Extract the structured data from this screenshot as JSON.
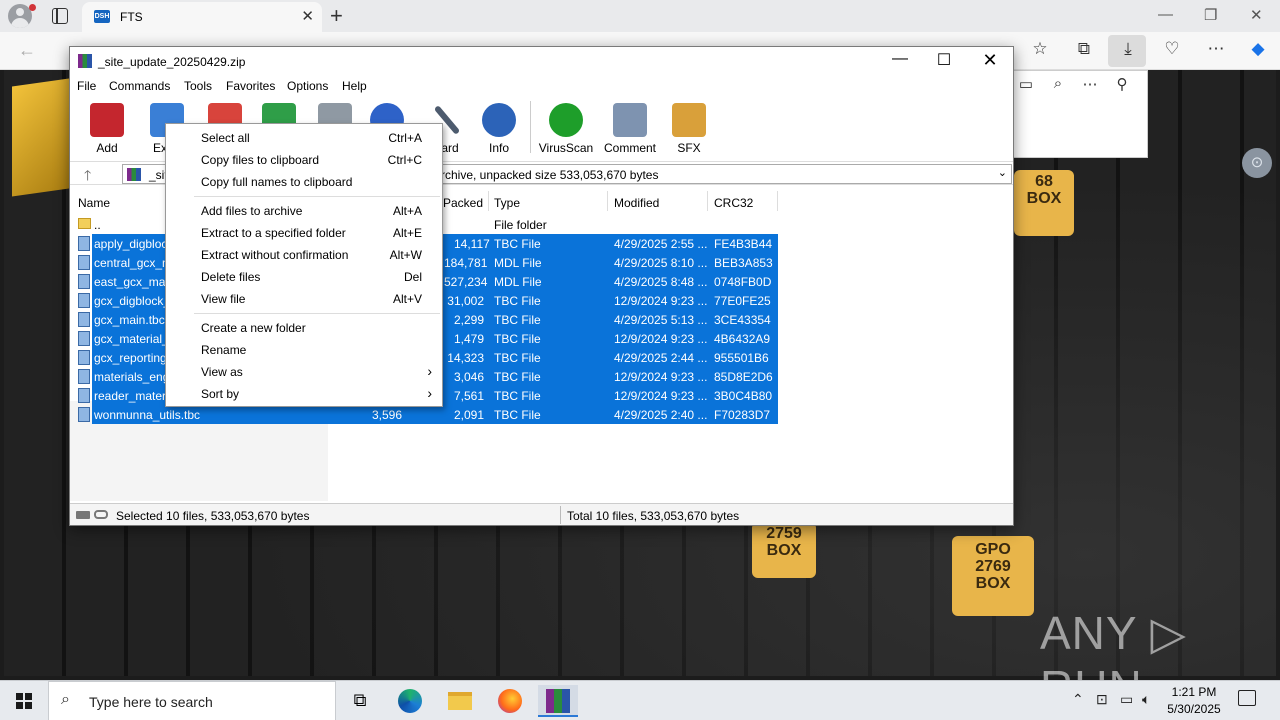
{
  "browser": {
    "tab_title": "FTS",
    "favicon_text": "DSH",
    "tab_close": "✕",
    "newtab": "+"
  },
  "winrar": {
    "title": "_site_update_20250429.zip",
    "menu": [
      "File",
      "Commands",
      "Tools",
      "Favorites",
      "Options",
      "Help"
    ],
    "toolbar": [
      {
        "label": "Add",
        "icon": "add-archive-icon",
        "color": "#c4262e"
      },
      {
        "label": "Extra",
        "icon": "extract-icon",
        "color": "#3a7fd6"
      },
      {
        "label": "",
        "icon": "test-icon",
        "color": "#d8443c"
      },
      {
        "label": "",
        "icon": "view-icon",
        "color": "#2f9e48"
      },
      {
        "label": "",
        "icon": "delete-icon",
        "color": "#8f99a3"
      },
      {
        "label": "",
        "icon": "find-icon",
        "color": "#2e62c8"
      },
      {
        "label": "zard",
        "icon": "wizard-icon",
        "color": "#4d5b6e"
      },
      {
        "label": "Info",
        "icon": "info-icon",
        "color": "#2c63b8"
      },
      {
        "label": "VirusScan",
        "icon": "virus-scan-icon",
        "color": "#1e9e2a"
      },
      {
        "label": "Comment",
        "icon": "comment-icon",
        "color": "#7e93b0"
      },
      {
        "label": "SFX",
        "icon": "sfx-icon",
        "color": "#d9a03a"
      }
    ],
    "path_prefix": "_sit",
    "path_info": "rchive, unpacked size 533,053,670 bytes",
    "columns": {
      "name": "Name",
      "packed": "Packed",
      "type": "Type",
      "modified": "Modified",
      "crc": "CRC32"
    },
    "parent_row": {
      "name": "..",
      "type": "File folder"
    },
    "files": [
      {
        "name": "apply_digbloc",
        "size": "",
        "packed": "14,117",
        "type": "TBC File",
        "modified": "4/29/2025 2:55 ...",
        "crc": "FE4B3B44"
      },
      {
        "name": "central_gcx_m",
        "size": "",
        "packed": "184,781",
        "type": "MDL File",
        "modified": "4/29/2025 8:10 ...",
        "crc": "BEB3A853"
      },
      {
        "name": "east_gcx_mas",
        "size": "",
        "packed": "527,234",
        "type": "MDL File",
        "modified": "4/29/2025 8:48 ...",
        "crc": "0748FB0D"
      },
      {
        "name": "gcx_digblock_",
        "size": "",
        "packed": "31,002",
        "type": "TBC File",
        "modified": "12/9/2024 9:23 ...",
        "crc": "77E0FE25"
      },
      {
        "name": "gcx_main.tbc",
        "size": "",
        "packed": "2,299",
        "type": "TBC File",
        "modified": "4/29/2025 5:13 ...",
        "crc": "3CE43354"
      },
      {
        "name": "gcx_material_",
        "size": "",
        "packed": "1,479",
        "type": "TBC File",
        "modified": "12/9/2024 9:23 ...",
        "crc": "4B6432A9"
      },
      {
        "name": "gcx_reporting",
        "size": "",
        "packed": "14,323",
        "type": "TBC File",
        "modified": "4/29/2025 2:44 ...",
        "crc": "955501B6"
      },
      {
        "name": "materials_eng",
        "size": "",
        "packed": "3,046",
        "type": "TBC File",
        "modified": "12/9/2024 9:23 ...",
        "crc": "85D8E2D6"
      },
      {
        "name": "reader_materi",
        "size": "",
        "packed": "7,561",
        "type": "TBC File",
        "modified": "12/9/2024 9:23 ...",
        "crc": "3B0C4B80"
      },
      {
        "name": "wonmunna_utils.tbc",
        "size": "3,596",
        "packed": "2,091",
        "type": "TBC File",
        "modified": "4/29/2025 2:40 ...",
        "crc": "F70283D7"
      }
    ],
    "status_left": "Selected 10 files, 533,053,670 bytes",
    "status_right": "Total 10 files, 533,053,670 bytes"
  },
  "context_menu": [
    {
      "label": "Select all",
      "shortcut": "Ctrl+A"
    },
    {
      "label": "Copy files to clipboard",
      "shortcut": "Ctrl+C"
    },
    {
      "label": "Copy full names to clipboard",
      "shortcut": ""
    },
    {
      "label": "Add files to archive",
      "shortcut": "Alt+A"
    },
    {
      "label": "Extract to a specified folder",
      "shortcut": "Alt+E"
    },
    {
      "label": "Extract without confirmation",
      "shortcut": "Alt+W"
    },
    {
      "label": "Delete files",
      "shortcut": "Del"
    },
    {
      "label": "View file",
      "shortcut": "Alt+V"
    },
    {
      "label": "Create a new folder",
      "shortcut": ""
    },
    {
      "label": "Rename",
      "shortcut": ""
    },
    {
      "label": "View as",
      "shortcut": "",
      "submenu": true
    },
    {
      "label": "Sort by",
      "shortcut": "",
      "submenu": true
    }
  ],
  "desktop": {
    "box_labels": [
      {
        "text": "68\nBOX"
      },
      {
        "text": "2759\nBOX"
      },
      {
        "text": "GPO\n2769\nBOX"
      }
    ],
    "watermark": "ANY ▷ RUN"
  },
  "taskbar": {
    "search_placeholder": "Type here to search",
    "time": "1:21 PM",
    "date": "5/30/2025"
  }
}
